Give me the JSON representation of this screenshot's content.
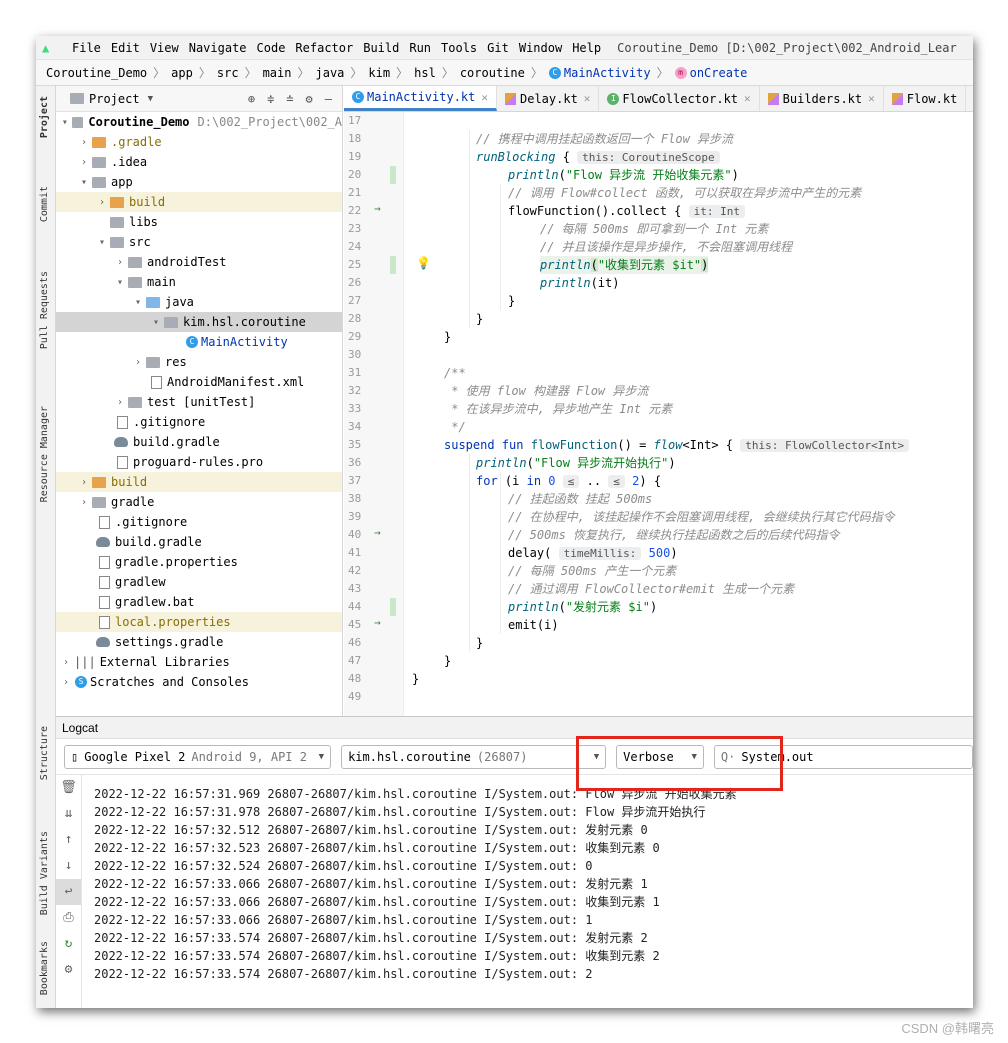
{
  "menu": {
    "items": [
      "File",
      "Edit",
      "View",
      "Navigate",
      "Code",
      "Refactor",
      "Build",
      "Run",
      "Tools",
      "Git",
      "Window",
      "Help"
    ],
    "window_title": "Coroutine_Demo [D:\\002_Project\\002_Android_Lear"
  },
  "breadcrumb": [
    "Coroutine_Demo",
    "app",
    "src",
    "main",
    "java",
    "kim",
    "hsl",
    "coroutine",
    "MainActivity",
    "onCreate"
  ],
  "side_tabs": [
    "Project",
    "Commit",
    "Pull Requests",
    "Resource Manager",
    "Structure",
    "Build Variants",
    "Bookmarks"
  ],
  "project": {
    "title": "Project",
    "root_name": "Coroutine_Demo",
    "root_path": "D:\\002_Project\\002_A",
    "tree": [
      {
        "label": ".gradle"
      },
      {
        "label": ".idea"
      },
      {
        "label": "app"
      },
      {
        "label": "build"
      },
      {
        "label": "libs"
      },
      {
        "label": "src"
      },
      {
        "label": "androidTest"
      },
      {
        "label": "main"
      },
      {
        "label": "java"
      },
      {
        "label": "kim.hsl.coroutine"
      },
      {
        "label": "MainActivity"
      },
      {
        "label": "res"
      },
      {
        "label": "AndroidManifest.xml"
      },
      {
        "label": "test [unitTest]"
      },
      {
        "label": ".gitignore"
      },
      {
        "label": "build.gradle"
      },
      {
        "label": "proguard-rules.pro"
      },
      {
        "label": "build"
      },
      {
        "label": "gradle"
      },
      {
        "label": ".gitignore"
      },
      {
        "label": "build.gradle"
      },
      {
        "label": "gradle.properties"
      },
      {
        "label": "gradlew"
      },
      {
        "label": "gradlew.bat"
      },
      {
        "label": "local.properties"
      },
      {
        "label": "settings.gradle"
      },
      {
        "label": "External Libraries"
      },
      {
        "label": "Scratches and Consoles"
      }
    ]
  },
  "editor": {
    "tabs": [
      "MainActivity.kt",
      "Delay.kt",
      "FlowCollector.kt",
      "Builders.kt",
      "Flow.kt"
    ],
    "line_numbers": [
      "17",
      "18",
      "19",
      "20",
      "21",
      "22",
      "23",
      "24",
      "25",
      "26",
      "27",
      "28",
      "29",
      "30",
      "31",
      "32",
      "33",
      "34",
      "35",
      "36",
      "37",
      "38",
      "39",
      "40",
      "41",
      "42",
      "43",
      "44",
      "45",
      "46",
      "47",
      "48",
      "49"
    ],
    "code": {
      "l18": "// 携程中调用挂起函数返回一个 Flow 异步流",
      "l19_fn": "runBlocking",
      "l19_hint": "this: CoroutineScope",
      "l20_str": "\"Flow 异步流 开始收集元素\"",
      "l21": "// 调用 Flow#collect 函数, 可以获取在异步流中产生的元素",
      "l22_fn": "flowFunction().collect",
      "l22_hint": "it: Int",
      "l23": "// 每隔 500ms 即可拿到一个 Int 元素",
      "l24": "// 并且该操作是异步操作, 不会阻塞调用线程",
      "l25_str": "\"收集到元素 $it\"",
      "l26_arg": "(it)",
      "l31": "/**",
      "l32": " * 使用 flow 构建器 Flow 异步流",
      "l33": " * 在该异步流中, 异步地产生 Int 元素",
      "l34": " */",
      "l35_fn": "flowFunction",
      "l35_hint": "this: FlowCollector<Int>",
      "l36_str": "\"Flow 异步流开始执行\"",
      "l38": "// 挂起函数 挂起 500ms",
      "l39": "// 在协程中, 该挂起操作不会阻塞调用线程, 会继续执行其它代码指令",
      "l40": "// 500ms 恢复执行, 继续执行挂起函数之后的后续代码指令",
      "l41_hint": "timeMillis:",
      "l41_num": "500",
      "l42": "// 每隔 500ms 产生一个元素",
      "l43": "// 通过调用 FlowCollector#emit 生成一个元素",
      "l44_str": "\"发射元素 $i\"",
      "l45": "emit(i)"
    }
  },
  "logcat": {
    "title": "Logcat",
    "device": "Google Pixel 2",
    "device_detail": "Android 9, API 2",
    "process": "kim.hsl.coroutine",
    "pid": "(26807)",
    "level": "Verbose",
    "search": "System.out",
    "lines": [
      "2022-12-22 16:57:31.969 26807-26807/kim.hsl.coroutine I/System.out: Flow 异步流 开始收集元素",
      "2022-12-22 16:57:31.978 26807-26807/kim.hsl.coroutine I/System.out: Flow 异步流开始执行",
      "2022-12-22 16:57:32.512 26807-26807/kim.hsl.coroutine I/System.out: 发射元素 0",
      "2022-12-22 16:57:32.523 26807-26807/kim.hsl.coroutine I/System.out: 收集到元素 0",
      "2022-12-22 16:57:32.524 26807-26807/kim.hsl.coroutine I/System.out: 0",
      "2022-12-22 16:57:33.066 26807-26807/kim.hsl.coroutine I/System.out: 发射元素 1",
      "2022-12-22 16:57:33.066 26807-26807/kim.hsl.coroutine I/System.out: 收集到元素 1",
      "2022-12-22 16:57:33.066 26807-26807/kim.hsl.coroutine I/System.out: 1",
      "2022-12-22 16:57:33.574 26807-26807/kim.hsl.coroutine I/System.out: 发射元素 2",
      "2022-12-22 16:57:33.574 26807-26807/kim.hsl.coroutine I/System.out: 收集到元素 2",
      "2022-12-22 16:57:33.574 26807-26807/kim.hsl.coroutine I/System.out: 2"
    ]
  },
  "watermark": "CSDN @韩曙亮",
  "colors": {
    "highlight_box": "#e3251b",
    "active_tab": "#4083c9"
  }
}
